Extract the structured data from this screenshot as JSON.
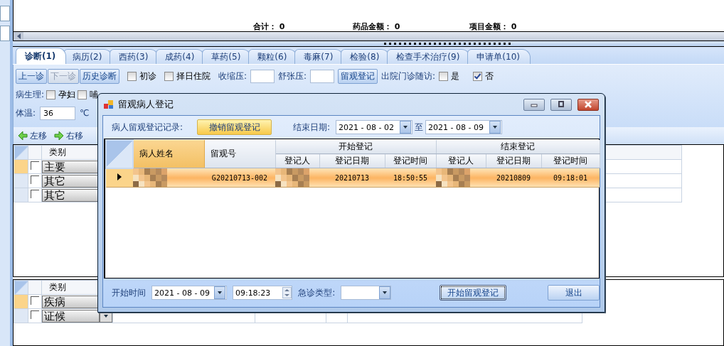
{
  "totals": [
    {
      "label": "合计：",
      "value": "0"
    },
    {
      "label": "药品金额：",
      "value": "0"
    },
    {
      "label": "项目金额：",
      "value": "0"
    }
  ],
  "tabs": [
    {
      "label": "诊断(1)",
      "selected": true
    },
    {
      "label": "病历(2)",
      "selected": false
    },
    {
      "label": "西药(3)",
      "selected": false
    },
    {
      "label": "成药(4)",
      "selected": false
    },
    {
      "label": "草药(5)",
      "selected": false
    },
    {
      "label": "颗粒(6)",
      "selected": false
    },
    {
      "label": "毒麻(7)",
      "selected": false
    },
    {
      "label": "检验(8)",
      "selected": false
    },
    {
      "label": "检查手术治疗(9)",
      "selected": false
    },
    {
      "label": "申请单(10)",
      "selected": false
    }
  ],
  "toolbar": {
    "buttons": [
      {
        "label": "上一诊",
        "disabled": false
      },
      {
        "label": "下一诊",
        "disabled": true
      },
      {
        "label": "历史诊断",
        "disabled": false
      }
    ],
    "checks": [
      {
        "label": "初诊",
        "checked": false
      },
      {
        "label": "择日住院",
        "checked": false
      }
    ],
    "pressure_fields": [
      {
        "label": "收缩压:"
      },
      {
        "label": "舒张压:"
      }
    ],
    "observe_button": "留观登记",
    "followup": {
      "label": "出院门诊随访:",
      "options": [
        {
          "label": "是",
          "checked": false
        },
        {
          "label": "否",
          "checked": true
        }
      ]
    }
  },
  "physiology": {
    "label": "病生理:",
    "options": [
      {
        "label": "孕妇",
        "checked": false
      },
      {
        "label": "哺",
        "checked": false
      }
    ]
  },
  "temperature": {
    "label": "体温:",
    "value": "36",
    "unit": "℃"
  },
  "move_buttons": [
    {
      "label": "左移",
      "kind": "left"
    },
    {
      "label": "右移",
      "kind": "right"
    }
  ],
  "upper_grid": {
    "column": "类别",
    "rows": [
      {
        "category": "主要",
        "checked": false,
        "selected": true
      },
      {
        "category": "其它",
        "checked": false,
        "selected": false
      },
      {
        "category": "其它",
        "checked": false,
        "selected": false
      }
    ]
  },
  "lower_grid": {
    "column": "类别",
    "rows": [
      {
        "category": "疾病",
        "checked": false,
        "selected": true
      },
      {
        "category": "证候",
        "checked": false,
        "selected": false
      }
    ]
  },
  "dialog": {
    "title": "留观病人登记",
    "records_label": "病人留观登记记录:",
    "cancel_button": "撤销留观登记",
    "end_date_label": "结束日期:",
    "date_from": "2021 - 08 - 02",
    "range_sep": "至",
    "date_to": "2021 - 08 - 09",
    "columns": [
      {
        "label": "病人姓名",
        "highlighted": true
      },
      {
        "label": "留观号",
        "highlighted": false
      }
    ],
    "groups": [
      {
        "label": "开始登记",
        "columns": [
          "登记人",
          "登记日期",
          "登记时间"
        ]
      },
      {
        "label": "结束登记",
        "columns": [
          "登记人",
          "登记日期",
          "登记时间"
        ]
      }
    ],
    "rows": [
      {
        "selected": true,
        "cells": [
          {
            "kind": "redacted"
          },
          {
            "kind": "text",
            "text": "G20210713-002"
          },
          {
            "kind": "redacted"
          },
          {
            "kind": "text",
            "text": "20210713"
          },
          {
            "kind": "text",
            "text": "18:50:55"
          },
          {
            "kind": "redacted"
          },
          {
            "kind": "text",
            "text": "20210809"
          },
          {
            "kind": "text",
            "text": "09:18:01"
          }
        ]
      }
    ],
    "start_label": "开始时间",
    "start_date": "2021 - 08 - 09",
    "start_time": "09:18:23",
    "emergency_label": "急诊类型:",
    "start_button": {
      "label": "开始留观登记",
      "focused": true
    },
    "exit_button": "退出"
  }
}
